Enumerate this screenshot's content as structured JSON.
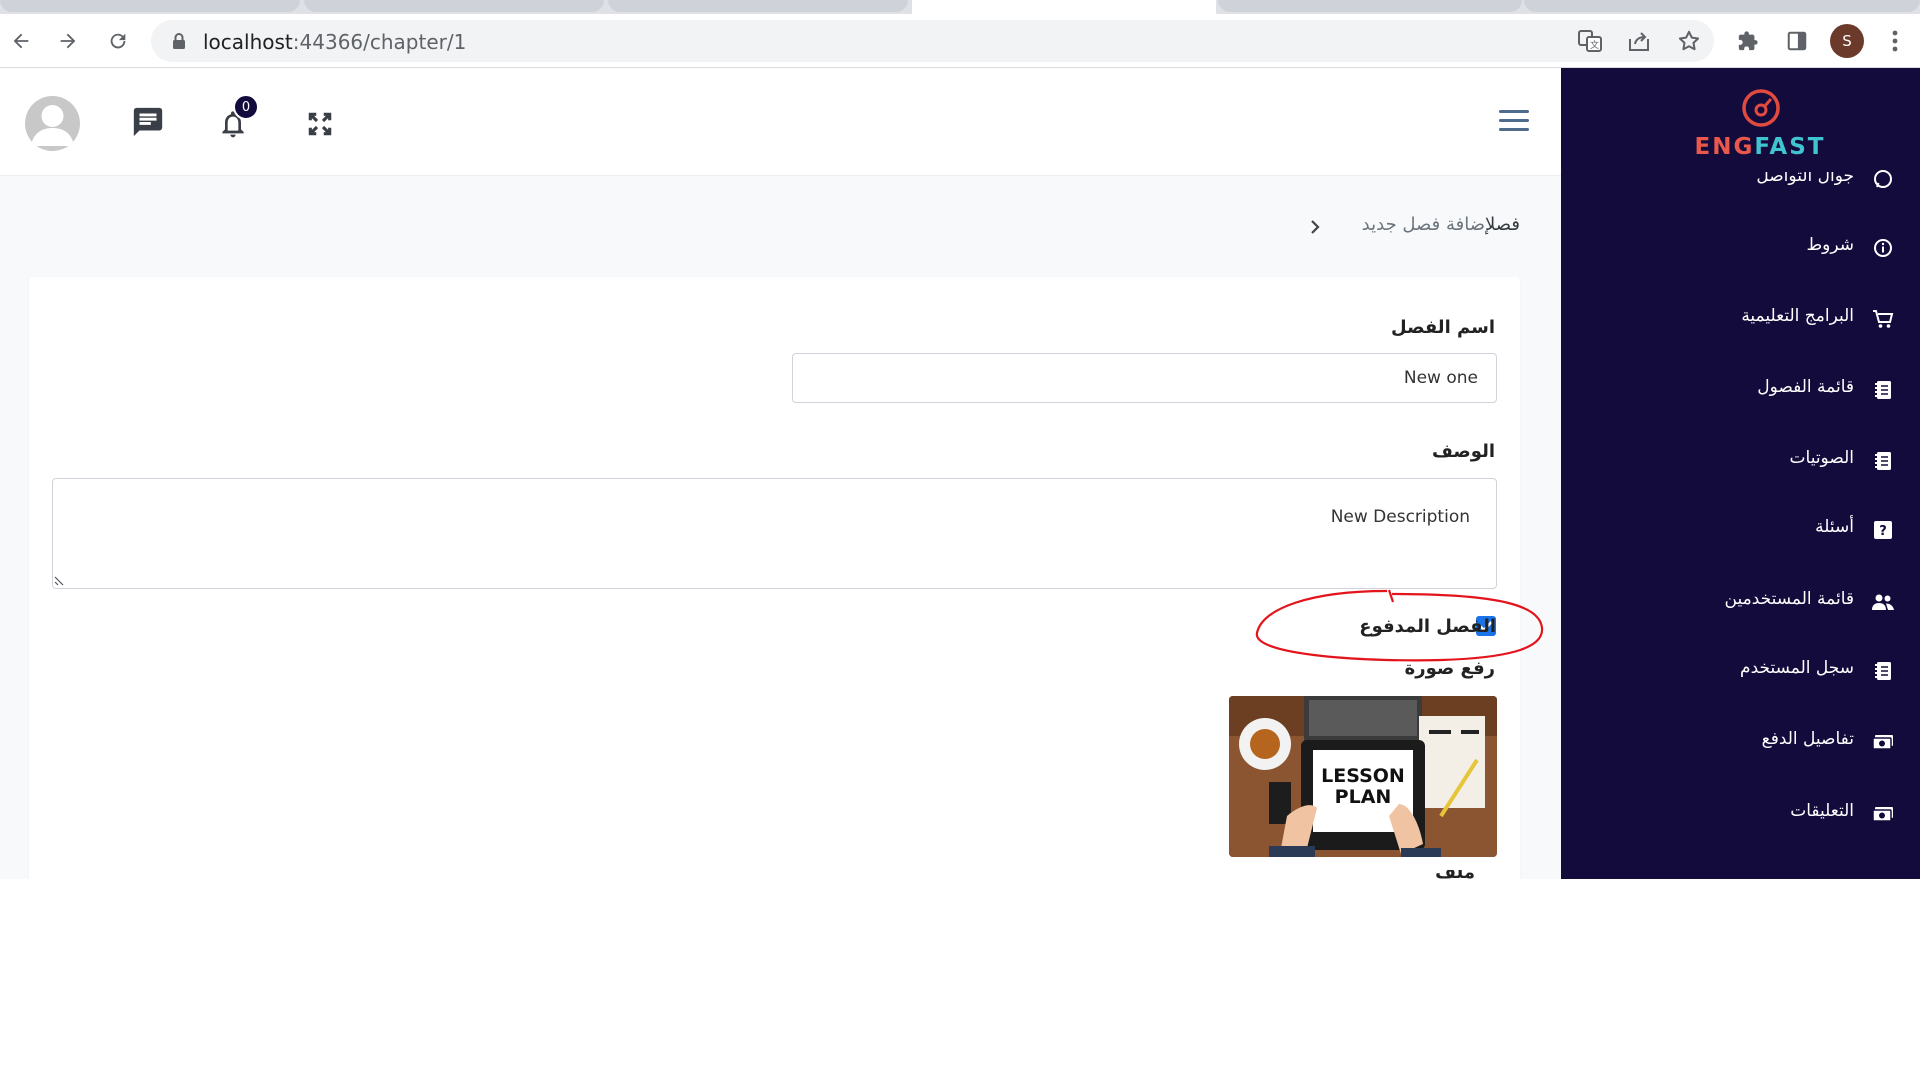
{
  "browser": {
    "url_host": "localhost",
    "url_path": ":44366/chapter/1",
    "profile_initial": "S"
  },
  "sidebar": {
    "logo": {
      "part1": "ENG",
      "part2": "FAST"
    },
    "items": [
      {
        "label": "جوال التواصل",
        "icon": "whatsapp-icon"
      },
      {
        "label": "شروط",
        "icon": "info-icon"
      },
      {
        "label": "البرامج التعليمية",
        "icon": "cart-icon"
      },
      {
        "label": "قائمة الفصول",
        "icon": "book-icon"
      },
      {
        "label": "الصوتيات",
        "icon": "book-icon"
      },
      {
        "label": "أسئلة",
        "icon": "question-icon"
      },
      {
        "label": "قائمة المستخدمين",
        "icon": "users-icon"
      },
      {
        "label": "سجل المستخدم",
        "icon": "book-icon"
      },
      {
        "label": "تفاصيل الدفع",
        "icon": "money-icon"
      },
      {
        "label": "التعليقات",
        "icon": "money-icon"
      }
    ]
  },
  "header": {
    "notification_count": "0"
  },
  "breadcrumb": {
    "root": "فصل",
    "current": "إضافة فصل جديد"
  },
  "form": {
    "chapter_name_label": "اسم الفصل",
    "chapter_name_value": "New one",
    "description_label": "الوصف",
    "description_value": "New Description",
    "paid_label": "الفصل المدفوع",
    "paid_checked": true,
    "upload_label": "رفع صورة",
    "preview_text_line1": "LESSON",
    "preview_text_line2": "PLAN",
    "next_label": "ملف الفصل"
  },
  "colors": {
    "sidebar_bg": "#140b3d",
    "accent_red": "#e8584b",
    "accent_teal": "#40c4cf",
    "highlight_red": "#e3141c",
    "checkbox_blue": "#1a73e8"
  }
}
